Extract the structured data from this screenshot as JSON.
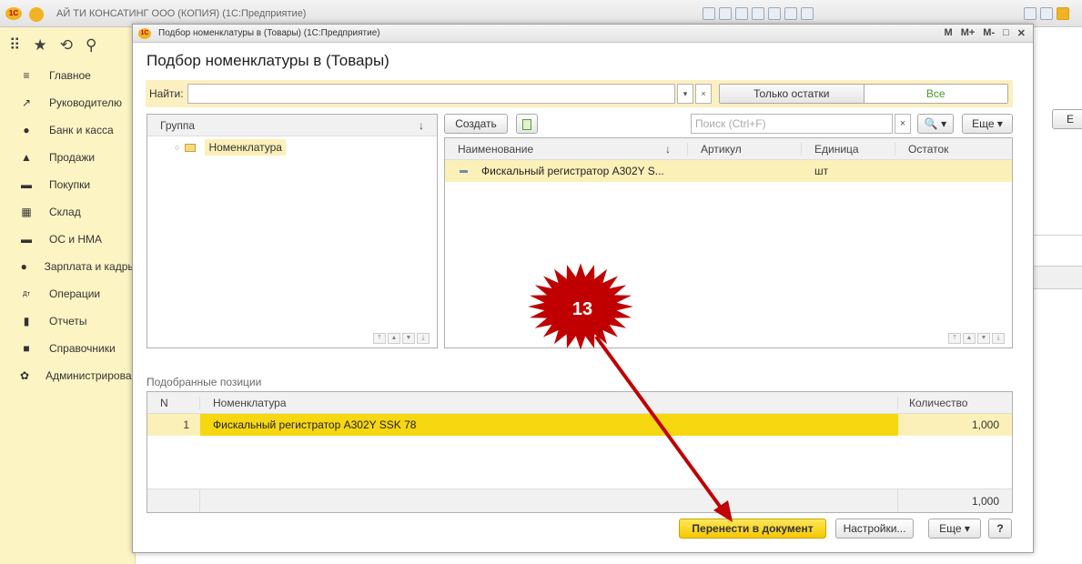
{
  "app": {
    "title": "АЙ ТИ КОНСАТИНГ ООО (КОПИЯ)  (1С:Предприятие)",
    "logo": "1С"
  },
  "sidebar": {
    "items": [
      {
        "icon": "≡",
        "icon_name": "menu-icon",
        "label": "Главное"
      },
      {
        "icon": "↗",
        "icon_name": "trend-icon",
        "label": "Руководителю"
      },
      {
        "icon": "●",
        "icon_name": "coin-icon",
        "label": "Банк и касса"
      },
      {
        "icon": "▲",
        "icon_name": "bag-icon",
        "label": "Продажи"
      },
      {
        "icon": "▬",
        "icon_name": "cart-icon",
        "label": "Покупки"
      },
      {
        "icon": "▦",
        "icon_name": "warehouse-icon",
        "label": "Склад"
      },
      {
        "icon": "▬",
        "icon_name": "truck-icon",
        "label": "ОС и НМА"
      },
      {
        "icon": "●",
        "icon_name": "person-icon",
        "label": "Зарплата и кадры"
      },
      {
        "icon": "Дт",
        "icon_name": "operations-icon",
        "label": "Операции"
      },
      {
        "icon": "▮",
        "icon_name": "chart-icon",
        "label": "Отчеты"
      },
      {
        "icon": "■",
        "icon_name": "book-icon",
        "label": "Справочники"
      },
      {
        "icon": "✿",
        "icon_name": "gear-icon",
        "label": "Администрирование"
      }
    ]
  },
  "dialog": {
    "window_title": "Подбор номенклатуры в  (Товары)  (1С:Предприятие)",
    "heading": "Подбор номенклатуры в  (Товары)",
    "titlebar_controls": [
      "M",
      "M+",
      "M-",
      "□",
      "✕"
    ],
    "find": {
      "label": "Найти:",
      "value": "",
      "dropdown": "▾",
      "clear": "×"
    },
    "filter": {
      "left": "Только остатки",
      "right": "Все"
    },
    "groups": {
      "header": "Группа",
      "sort_arrow": "↓",
      "items": [
        {
          "label": "Номенклатура"
        }
      ]
    },
    "items_panel": {
      "create_button": "Создать",
      "search_placeholder": "Поиск (Ctrl+F)",
      "search_clear": "×",
      "more_button": "Еще ▾",
      "find_button": "🔍 ▾",
      "columns": [
        "Наименование",
        "Артикул",
        "Единица",
        "Остаток"
      ],
      "sort_arrow": "↓",
      "rows": [
        {
          "name": "Фискальный регистратор A302Y S...",
          "article": "",
          "unit": "шт",
          "remainder": ""
        }
      ]
    },
    "picked": {
      "label": "Подобранные позиции",
      "columns": [
        "N",
        "Номенклатура",
        "Количество"
      ],
      "rows": [
        {
          "n": "1",
          "name": "Фискальный регистратор A302Y SSK 78",
          "qty": "1,000"
        }
      ],
      "total": "1,000"
    },
    "footer": {
      "transfer": "Перенести в документ",
      "settings": "Настройки...",
      "more": "Еще ▾",
      "help": "?"
    }
  },
  "annotation": {
    "step_number": "13",
    "color": "#c00000"
  },
  "right_partial": {
    "button": "Е"
  }
}
